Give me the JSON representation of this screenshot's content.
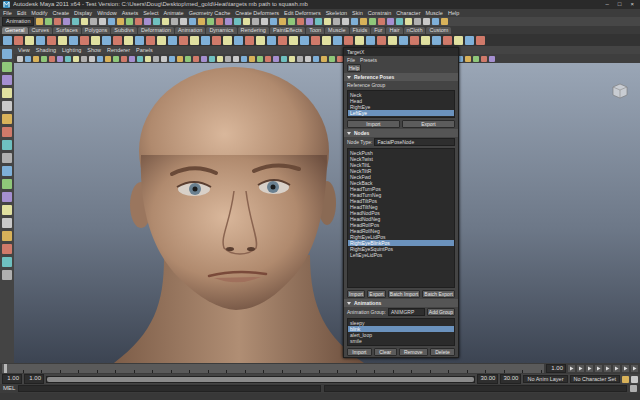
{
  "window": {
    "title": "Autodesk Maya 2011 x64 - Test Version: C:\\Users\\Doug\\Desktop\\med_gold\\Heat\\targets mb path to squash.mb",
    "controls": [
      "–",
      "□",
      "×"
    ]
  },
  "menus": [
    "File",
    "Edit",
    "Modify",
    "Create",
    "Display",
    "Window",
    "Assets",
    "Select",
    "Animate",
    "Geometry Cache",
    "Create Deformers",
    "Edit Deformers",
    "Skeleton",
    "Skin",
    "Constrain",
    "Character",
    "Muscle",
    "Help"
  ],
  "status_line": {
    "menu_set": "Animation"
  },
  "shelf_tabs": [
    {
      "label": "General",
      "selected": true
    },
    {
      "label": "Curves",
      "selected": false
    },
    {
      "label": "Surfaces",
      "selected": false
    },
    {
      "label": "Polygons",
      "selected": false
    },
    {
      "label": "Subdivs",
      "selected": false
    },
    {
      "label": "Deformation",
      "selected": false
    },
    {
      "label": "Animation",
      "selected": false
    },
    {
      "label": "Dynamics",
      "selected": false
    },
    {
      "label": "Rendering",
      "selected": false
    },
    {
      "label": "PaintEffects",
      "selected": false
    },
    {
      "label": "Toon",
      "selected": false
    },
    {
      "label": "Muscle",
      "selected": false
    },
    {
      "label": "Fluids",
      "selected": false
    },
    {
      "label": "Fur",
      "selected": false
    },
    {
      "label": "Hair",
      "selected": false
    },
    {
      "label": "nCloth",
      "selected": false
    },
    {
      "label": "Custom",
      "selected": false
    }
  ],
  "panel_menu": [
    "View",
    "Shading",
    "Lighting",
    "Show",
    "Renderer",
    "Panels"
  ],
  "tool_window": {
    "title": "TargetX",
    "menus": [
      "File",
      "Presets"
    ],
    "help_button": "Help",
    "reference_poses": {
      "title": "Reference Poses",
      "expanded": true,
      "list_label": "Reference Group",
      "items": [
        {
          "label": "Neck",
          "selected": false
        },
        {
          "label": "Head",
          "selected": false
        },
        {
          "label": "RightEye",
          "selected": false
        },
        {
          "label": "LeftEye",
          "selected": true
        }
      ],
      "buttons": [
        "Import",
        "Export"
      ]
    },
    "nodes": {
      "title": "Nodes",
      "expanded": true,
      "field_label": "Node Type:",
      "field_value": "FacialPoseNode",
      "items": [
        {
          "label": "NeckPush",
          "selected": false
        },
        {
          "label": "NeckTwist",
          "selected": false
        },
        {
          "label": "NeckTiltL",
          "selected": false
        },
        {
          "label": "NeckTiltR",
          "selected": false
        },
        {
          "label": "NeckFwd",
          "selected": false
        },
        {
          "label": "NeckBack",
          "selected": false
        },
        {
          "label": "HeadTurnPos",
          "selected": false
        },
        {
          "label": "HeadTurnNeg",
          "selected": false
        },
        {
          "label": "HeadTiltPos",
          "selected": false
        },
        {
          "label": "HeadTiltNeg",
          "selected": false
        },
        {
          "label": "HeadNodPos",
          "selected": false
        },
        {
          "label": "HeadNodNeg",
          "selected": false
        },
        {
          "label": "HeadRollPos",
          "selected": false
        },
        {
          "label": "HeadRollNeg",
          "selected": false
        },
        {
          "label": "RightEyeLidPos",
          "selected": false
        },
        {
          "label": "RightEyeBlinkPos",
          "selected": true
        },
        {
          "label": "RightEyeSquintPos",
          "selected": false
        },
        {
          "label": "LeftEyeLidPos",
          "selected": false
        }
      ],
      "buttons": [
        "Import",
        "Export",
        "Batch Import",
        "Batch Export"
      ]
    },
    "animations": {
      "title": "Animations",
      "expanded": true,
      "field_label": "Animation Group:",
      "field_value": "ANIMGRP",
      "add_button": "Add Group",
      "items": [
        {
          "label": "sleepy",
          "selected": false
        },
        {
          "label": "blink",
          "selected": true
        },
        {
          "label": "alert_loop",
          "selected": false
        },
        {
          "label": "smile",
          "selected": false
        }
      ],
      "buttons": [
        "Import",
        "Clear",
        "Remove",
        "Delete"
      ]
    }
  },
  "time_slider": {
    "current_time": "1.00"
  },
  "range_slider": {
    "start": "1.00",
    "range_start": "1.00",
    "range_end": "30.00",
    "end": "30.00",
    "level": 1
  },
  "anim_layer": "No Anim Layer",
  "character_set": "No Character Set",
  "command_line": {
    "language": "MEL"
  }
}
